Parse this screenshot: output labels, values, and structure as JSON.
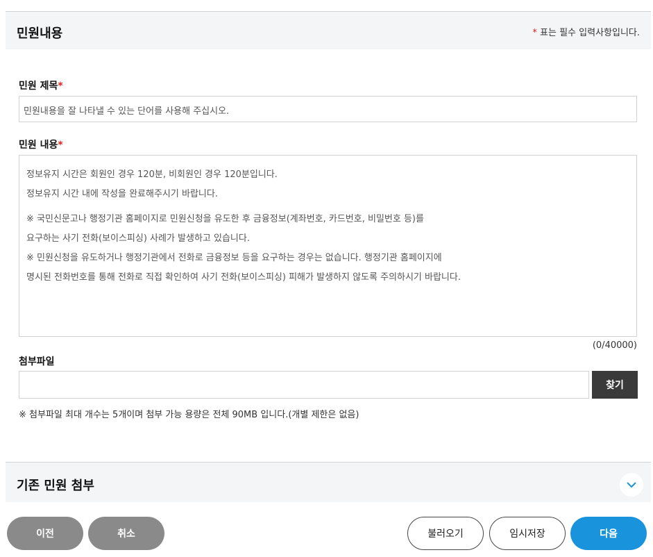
{
  "section": {
    "title": "민원내용",
    "required_star": "*",
    "required_note": " 표는 필수 입력사항입니다."
  },
  "subject": {
    "label": "민원 제목",
    "star": "*",
    "placeholder": "민원내용을 잘 나타낼 수 있는 단어를 사용해 주십시오."
  },
  "content": {
    "label": "민원 내용",
    "star": "*",
    "lines": [
      "정보유지 시간은 회원인 경우 120분, 비회원인 경우 120분입니다.",
      "정보유지 시간 내에 작성을 완료해주시기 바랍니다.",
      "※ 국민신문고나 행정기관 홈페이지로 민원신청을 유도한 후 금융정보(계좌번호, 카드번호, 비밀번호 등)를",
      "요구하는 사기 전화(보이스피싱) 사례가 발생하고 있습니다.",
      "※ 민원신청을 유도하거나 행정기관에서 전화로 금융정보 등을 요구하는 경우는 없습니다. 행정기관 홈페이지에",
      "명시된 전화번호를 통해 전화로 직접 확인하여 사기 전화(보이스피싱) 피해가 발생하지 않도록 주의하시기 바랍니다."
    ],
    "counter": "(0/40000)"
  },
  "attachment": {
    "label": "첨부파일",
    "find_button": "찾기",
    "note": "※ 첨부파일 최대 개수는 5개이며 첨부 가능 용량은 전체 90MB 입니다.(개별 제한은 없음)"
  },
  "existing": {
    "title": "기존 민원 첨부",
    "icon": "chevron-down-icon"
  },
  "buttons": {
    "prev": "이전",
    "cancel": "취소",
    "load": "불러오기",
    "temp_save": "임시저장",
    "next": "다음"
  },
  "colors": {
    "accent": "#1a93dd",
    "required": "#e02020",
    "dark_button": "#3a3a3a",
    "gray_button": "#8a8a8a"
  }
}
